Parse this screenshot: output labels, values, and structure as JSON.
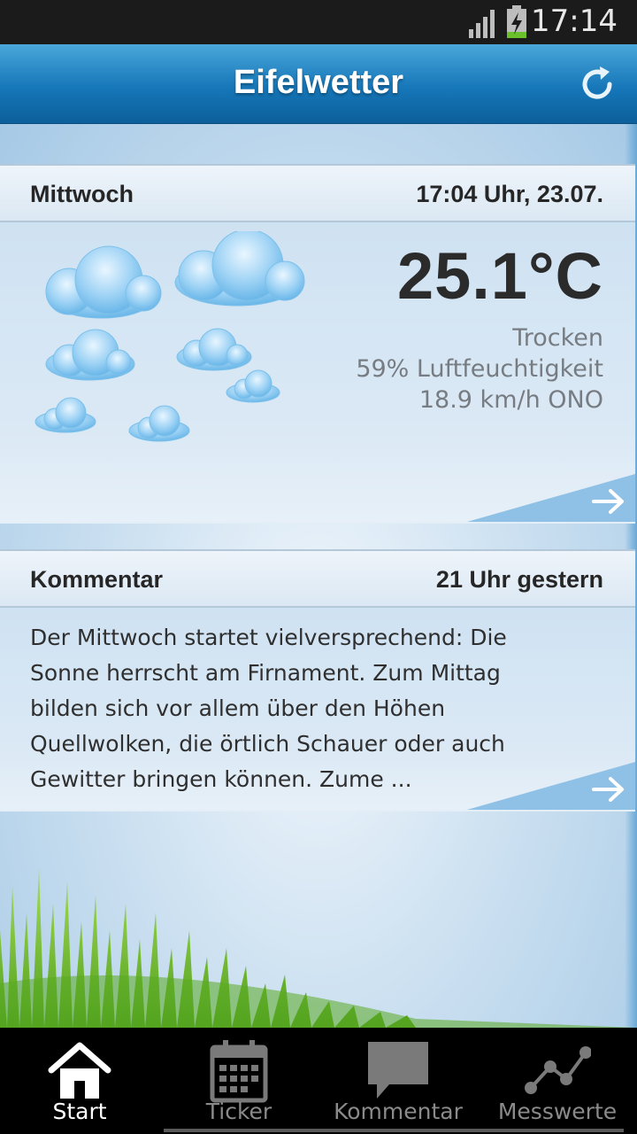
{
  "status_bar": {
    "time": "17:14"
  },
  "header": {
    "title": "Eifelwetter",
    "refresh_icon": "refresh-icon"
  },
  "weather": {
    "day": "Mittwoch",
    "datetime": "17:04 Uhr, 23.07.",
    "temperature": "25.1°C",
    "condition": "Trocken",
    "humidity": "59% Luftfeuchtigkeit",
    "wind": "18.9 km/h ONO",
    "icon": "clouds-icon"
  },
  "comment": {
    "title": "Kommentar",
    "time": "21 Uhr gestern",
    "lines": [
      "Der  Mittwoch startet vielversprechend: Die",
      "Sonne herrscht am Firnament. Zum Mittag",
      "bilden sich vor allem über den Höhen",
      "Quellwolken, die örtlich Schauer oder auch",
      "Gewitter bringen können. Zume ..."
    ]
  },
  "nav": {
    "items": [
      {
        "label": "Start",
        "icon": "home-icon",
        "active": true
      },
      {
        "label": "Ticker",
        "icon": "calendar-icon",
        "active": false
      },
      {
        "label": "Kommentar",
        "icon": "speech-bubble-icon",
        "active": false
      },
      {
        "label": "Messwerte",
        "icon": "graph-icon",
        "active": false
      }
    ]
  },
  "colors": {
    "action_bar": "#1677b9",
    "background": "#c3dbee",
    "nav_background": "#000000",
    "nav_active": "#ffffff",
    "nav_inactive": "#8a8a8a"
  }
}
